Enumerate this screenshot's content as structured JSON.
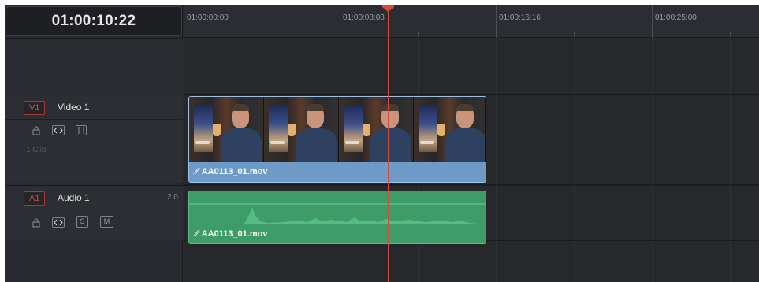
{
  "timecode": "01:00:10:22",
  "ruler": {
    "labels": [
      "01:00:00:00",
      "01:00:08:08",
      "01:00:16:16",
      "01:00:25:00"
    ]
  },
  "tracks": {
    "video": {
      "id": "V1",
      "name": "Video 1",
      "clip_count": "1 Clip",
      "clip": {
        "name": "AA0113_01.mov",
        "color": "#6d9ac6"
      }
    },
    "audio": {
      "id": "A1",
      "name": "Audio 1",
      "channels": "2.0",
      "solo_label": "S",
      "mute_label": "M",
      "clip": {
        "name": "AA0113_01.mov",
        "color": "#3e9c68"
      }
    }
  },
  "colors": {
    "playhead": "#d44a3f",
    "track_id_accent": "#d9483b",
    "background": "#282a2f"
  },
  "icons": {
    "lock": "lock-icon",
    "auto_select": "auto-select-icon",
    "track_visibility": "monitor-icon",
    "clip_link": "link-icon"
  }
}
